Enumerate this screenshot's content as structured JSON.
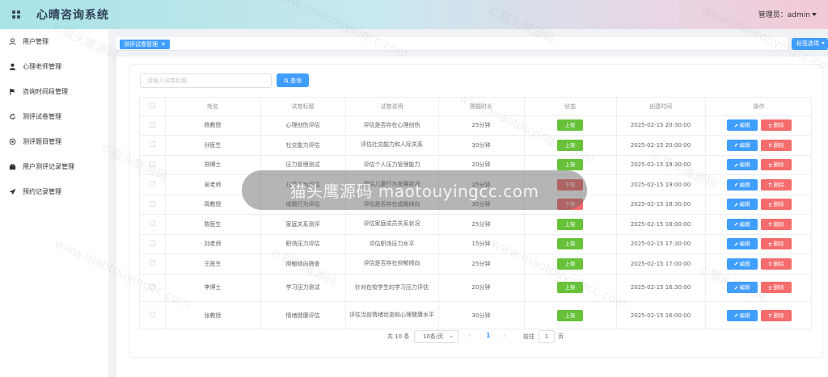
{
  "header": {
    "title": "心晴咨询系统",
    "admin_label": "管理员：admin"
  },
  "sidebar": {
    "items": [
      {
        "label": "用户管理",
        "icon": "user-icon"
      },
      {
        "label": "心理老师管理",
        "icon": "person-icon"
      },
      {
        "label": "咨询时间段管理",
        "icon": "flag-icon"
      },
      {
        "label": "测评试卷管理",
        "icon": "refresh-icon"
      },
      {
        "label": "测评题目管理",
        "icon": "dial-icon"
      },
      {
        "label": "用户测评记录管理",
        "icon": "briefcase-icon"
      },
      {
        "label": "预约记录管理",
        "icon": "paper-plane-icon"
      }
    ]
  },
  "tags": {
    "active_tag": "测评试卷管理",
    "tag_options": "标签选项"
  },
  "search": {
    "placeholder": "请输入试卷标题",
    "button": "查询"
  },
  "table": {
    "headers": [
      "姓名",
      "试卷标题",
      "试卷说明",
      "答题时长",
      "状态",
      "创建时间",
      "操作"
    ],
    "edit_label": "编辑",
    "delete_label": "删除",
    "rows": [
      {
        "name": "杨教授",
        "title": "心理创伤评估",
        "desc": "评估是否存在心理创伤",
        "duration": "25分钟",
        "status": "上架",
        "status_type": "on",
        "created": "2025-02-15 20:30:00"
      },
      {
        "name": "孙医生",
        "title": "社交能力评估",
        "desc": "评估社交能力和人际关系",
        "duration": "30分钟",
        "status": "上架",
        "status_type": "on",
        "created": "2025-02-15 20:00:00"
      },
      {
        "name": "郑博士",
        "title": "压力管理测试",
        "desc": "评估个人压力管理能力",
        "duration": "20分钟",
        "status": "上架",
        "status_type": "on",
        "created": "2025-02-15 19:30:00"
      },
      {
        "name": "吴老师",
        "title": "儿童行为评估",
        "desc": "评估儿童行为发展状况",
        "duration": "25分钟",
        "status": "下架",
        "status_type": "off",
        "created": "2025-02-15 19:00:00"
      },
      {
        "name": "周教授",
        "title": "成瘾行为评估",
        "desc": "评估是否存在成瘾倾向",
        "duration": "30分钟",
        "status": "下架",
        "status_type": "off",
        "created": "2025-02-15 18:30:00"
      },
      {
        "name": "陈医生",
        "title": "家庭关系测评",
        "desc": "评估家庭成员关系状况",
        "duration": "25分钟",
        "status": "上架",
        "status_type": "on",
        "created": "2025-02-15 18:00:00"
      },
      {
        "name": "刘老师",
        "title": "职场压力评估",
        "desc": "评估职场压力水平",
        "duration": "15分钟",
        "status": "上架",
        "status_type": "on",
        "created": "2025-02-15 17:30:00"
      },
      {
        "name": "王医生",
        "title": "抑郁倾向筛查",
        "desc": "评估是否存在抑郁倾向",
        "duration": "25分钟",
        "status": "上架",
        "status_type": "on",
        "created": "2025-02-15 17:00:00"
      },
      {
        "name": "李博士",
        "title": "学习压力测试",
        "desc": "针对在校学生的学习压力评估",
        "duration": "20分钟",
        "status": "上架",
        "status_type": "on",
        "created": "2025-02-15 16:30:00"
      },
      {
        "name": "张教授",
        "title": "情绪健康评估",
        "desc": "评估当前情绪状态和心理健康水平",
        "duration": "30分钟",
        "status": "上架",
        "status_type": "on",
        "created": "2025-02-15 16:00:00"
      }
    ]
  },
  "pagination": {
    "total": "共 10 条",
    "page_size": "10条/页",
    "prev": "‹",
    "current_page": "1",
    "next": "›",
    "goto_label": "前往",
    "goto_value": "1",
    "page_unit": "页"
  },
  "watermark": {
    "overlay_text": "猫头鹰源码 maotouyingcc.com",
    "tile_text_a": "©猫头鹰源码",
    "tile_text_b": "www.maotouyingcc.com"
  },
  "colors": {
    "primary": "#409eff",
    "success": "#67c23a",
    "danger": "#f56c6c"
  }
}
